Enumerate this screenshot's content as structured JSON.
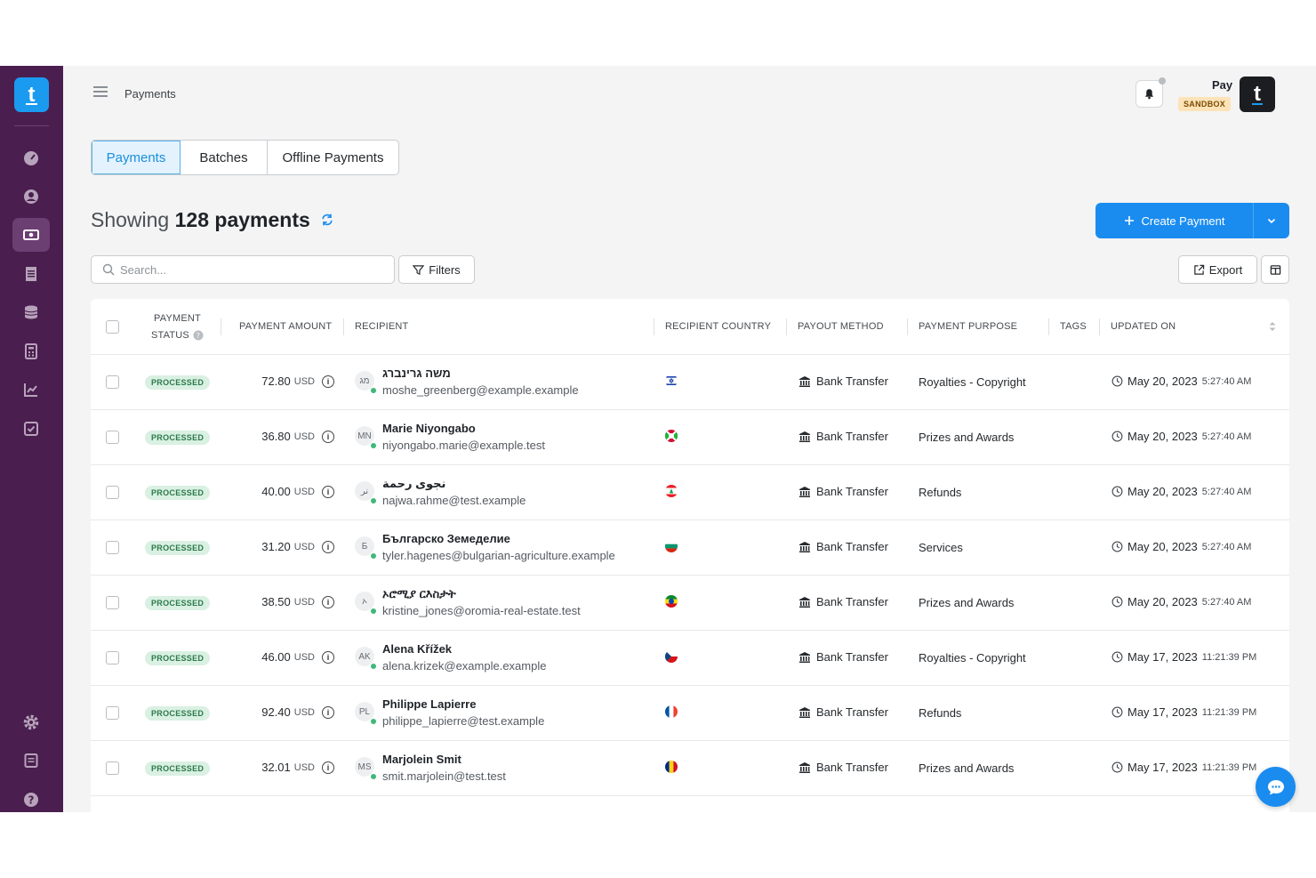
{
  "app": {
    "breadcrumb": "Payments",
    "account_name": "Pay",
    "environment_badge": "SANDBOX",
    "logo_letter": "t"
  },
  "tabs": [
    {
      "label": "Payments",
      "active": true
    },
    {
      "label": "Batches",
      "active": false
    },
    {
      "label": "Offline Payments",
      "active": false
    }
  ],
  "summary": {
    "prefix": "Showing",
    "count_text": "128 payments"
  },
  "actions": {
    "create_label": "Create Payment",
    "filters_label": "Filters",
    "export_label": "Export",
    "search_placeholder": "Search..."
  },
  "table": {
    "columns": {
      "status_line1": "PAYMENT",
      "status_line2": "STATUS",
      "amount": "PAYMENT AMOUNT",
      "recipient": "RECIPIENT",
      "country": "RECIPIENT COUNTRY",
      "payout": "PAYOUT METHOD",
      "purpose": "PAYMENT PURPOSE",
      "tags": "TAGS",
      "updated": "UPDATED ON"
    },
    "rows": [
      {
        "status": "PROCESSED",
        "amount": "72.80",
        "currency": "USD",
        "initials": "מג",
        "name": "משה גרינברג",
        "email": "moshe_greenberg@example.example",
        "flag": "il",
        "payout": "Bank Transfer",
        "purpose": "Royalties - Copyright",
        "date": "May 20, 2023",
        "time": "5:27:40 AM"
      },
      {
        "status": "PROCESSED",
        "amount": "36.80",
        "currency": "USD",
        "initials": "MN",
        "name": "Marie Niyongabo",
        "email": "niyongabo.marie@example.test",
        "flag": "bi",
        "payout": "Bank Transfer",
        "purpose": "Prizes and Awards",
        "date": "May 20, 2023",
        "time": "5:27:40 AM"
      },
      {
        "status": "PROCESSED",
        "amount": "40.00",
        "currency": "USD",
        "initials": "نر",
        "name": "نجوى رحمة",
        "email": "najwa.rahme@test.example",
        "flag": "lb",
        "payout": "Bank Transfer",
        "purpose": "Refunds",
        "date": "May 20, 2023",
        "time": "5:27:40 AM"
      },
      {
        "status": "PROCESSED",
        "amount": "31.20",
        "currency": "USD",
        "initials": "Б",
        "name": "Българско Земеделие",
        "email": "tyler.hagenes@bulgarian-agriculture.example",
        "flag": "bg",
        "payout": "Bank Transfer",
        "purpose": "Services",
        "date": "May 20, 2023",
        "time": "5:27:40 AM"
      },
      {
        "status": "PROCESSED",
        "amount": "38.50",
        "currency": "USD",
        "initials": "ኦ",
        "name": "ኦሮሚያ ርእስታት",
        "email": "kristine_jones@oromia-real-estate.test",
        "flag": "et",
        "payout": "Bank Transfer",
        "purpose": "Prizes and Awards",
        "date": "May 20, 2023",
        "time": "5:27:40 AM"
      },
      {
        "status": "PROCESSED",
        "amount": "46.00",
        "currency": "USD",
        "initials": "AK",
        "name": "Alena Křížek",
        "email": "alena.krizek@example.example",
        "flag": "cz",
        "payout": "Bank Transfer",
        "purpose": "Royalties - Copyright",
        "date": "May 17, 2023",
        "time": "11:21:39 PM"
      },
      {
        "status": "PROCESSED",
        "amount": "92.40",
        "currency": "USD",
        "initials": "PL",
        "name": "Philippe Lapierre",
        "email": "philippe_lapierre@test.example",
        "flag": "fr",
        "payout": "Bank Transfer",
        "purpose": "Refunds",
        "date": "May 17, 2023",
        "time": "11:21:39 PM"
      },
      {
        "status": "PROCESSED",
        "amount": "32.01",
        "currency": "USD",
        "initials": "MS",
        "name": "Marjolein Smit",
        "email": "smit.marjolein@test.test",
        "flag": "ro",
        "payout": "Bank Transfer",
        "purpose": "Prizes and Awards",
        "date": "May 17, 2023",
        "time": "11:21:39 PM"
      }
    ]
  },
  "colors": {
    "sidebar_bg": "#4a1e4f",
    "primary": "#1a8cf0",
    "status_processed_bg": "#d9f0e2",
    "status_processed_text": "#2c7a4b"
  }
}
